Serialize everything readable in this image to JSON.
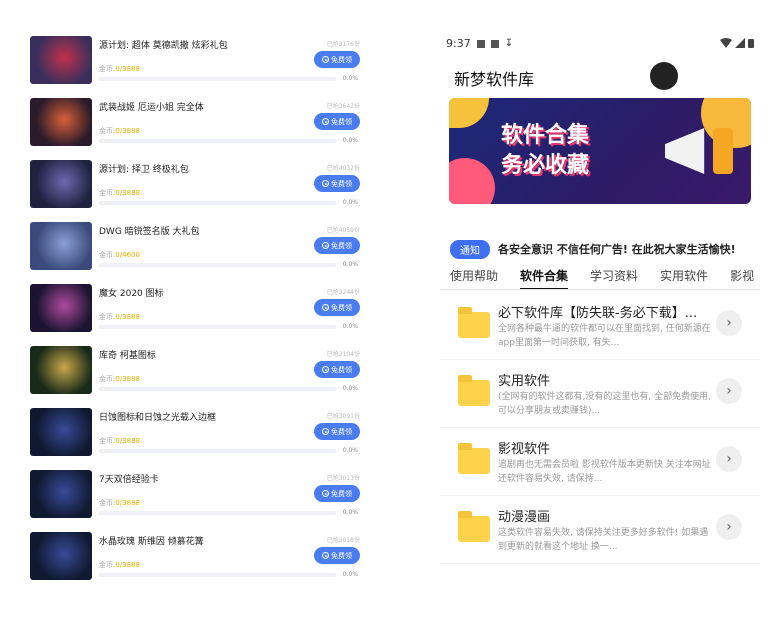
{
  "left": {
    "items": [
      {
        "title": "源计划: 超体 莫德凯撒 炫彩礼包",
        "price_label": "金币:",
        "price": "0/3888",
        "count": "已抢3176份",
        "button": "免费领",
        "progress": "0.0%",
        "colors": [
          "#3a2f5c",
          "#c0304a"
        ]
      },
      {
        "title": "武装战姬 厄运小姐 完全体",
        "price_label": "金币:",
        "price": "0/3888",
        "count": "已抢3642份",
        "button": "免费领",
        "progress": "0.0%",
        "colors": [
          "#2a1a2a",
          "#d8603a"
        ]
      },
      {
        "title": "源计划: 择卫 终极礼包",
        "price_label": "金币:",
        "price": "0/3888",
        "count": "已抢4032份",
        "button": "免费领",
        "progress": "0.0%",
        "colors": [
          "#1f2340",
          "#6a6ab0"
        ]
      },
      {
        "title": "DWG 暗锐签名版 大礼包",
        "price_label": "金币:",
        "price": "0/4600",
        "count": "已抢4059份",
        "button": "免费领",
        "progress": "0.0%",
        "colors": [
          "#3a4a7a",
          "#8aa0d8"
        ]
      },
      {
        "title": "魔女 2020 图标",
        "price_label": "金币:",
        "price": "0/3888",
        "count": "已抢3244份",
        "button": "免费领",
        "progress": "0.0%",
        "colors": [
          "#1a1430",
          "#b04aa0"
        ]
      },
      {
        "title": "库奇 柯基图标",
        "price_label": "金币:",
        "price": "0/3888",
        "count": "已抢3104份",
        "button": "免费领",
        "progress": "0.0%",
        "colors": [
          "#1a2a1a",
          "#c8a84a"
        ]
      },
      {
        "title": "日蚀图标和日蚀之光载入边框",
        "price_label": "金币:",
        "price": "0/3888",
        "count": "已抢3091份",
        "button": "免费领",
        "progress": "0.0%",
        "colors": [
          "#0f1a30",
          "#3a4a9a"
        ]
      },
      {
        "title": "7天双倍经验卡",
        "price_label": "金币:",
        "price": "0/3888",
        "count": "已抢3013份",
        "button": "免费领",
        "progress": "0.0%",
        "colors": [
          "#0f1a30",
          "#3a4a9a"
        ]
      },
      {
        "title": "水晶玫瑰 斯维因 倾慕花篝",
        "price_label": "金币:",
        "price": "0/3888",
        "count": "已抢3018份",
        "button": "免费领",
        "progress": "0.0%",
        "colors": [
          "#0f1a30",
          "#3a4a9a"
        ]
      }
    ]
  },
  "right": {
    "status_time": "9:37",
    "app_title": "新梦软件库",
    "banner_text": [
      "软件合集",
      "务必收藏"
    ],
    "notice_tag": "通知",
    "notice_text": "各安全意识 不信任何广告! 在此祝大家生活愉快!",
    "tabs": [
      "使用帮助",
      "软件合集",
      "学习资料",
      "实用软件",
      "影视"
    ],
    "active_tab": 1,
    "items": [
      {
        "title": "必下软件库【防失联-务必下载】...",
        "desc": "全网各种最牛逼的软件都可以在里面找到, 任何新源在app里面第一时间获取, 有失..."
      },
      {
        "title": "实用软件",
        "desc": "(全网有的软件这都有,没有的这里也有, 全部免费使用,可以分享朋友或卖赚钱)..."
      },
      {
        "title": "影视软件",
        "desc": "追剧再也无需会员啦 影视软件版本更新快 关注本网址还软件容易失效, 请保持..."
      },
      {
        "title": "动漫漫画",
        "desc": "这类软件容易失效, 请保持关注更多好多软件! 如果遇到更新的就看这个地址 换一..."
      }
    ]
  }
}
